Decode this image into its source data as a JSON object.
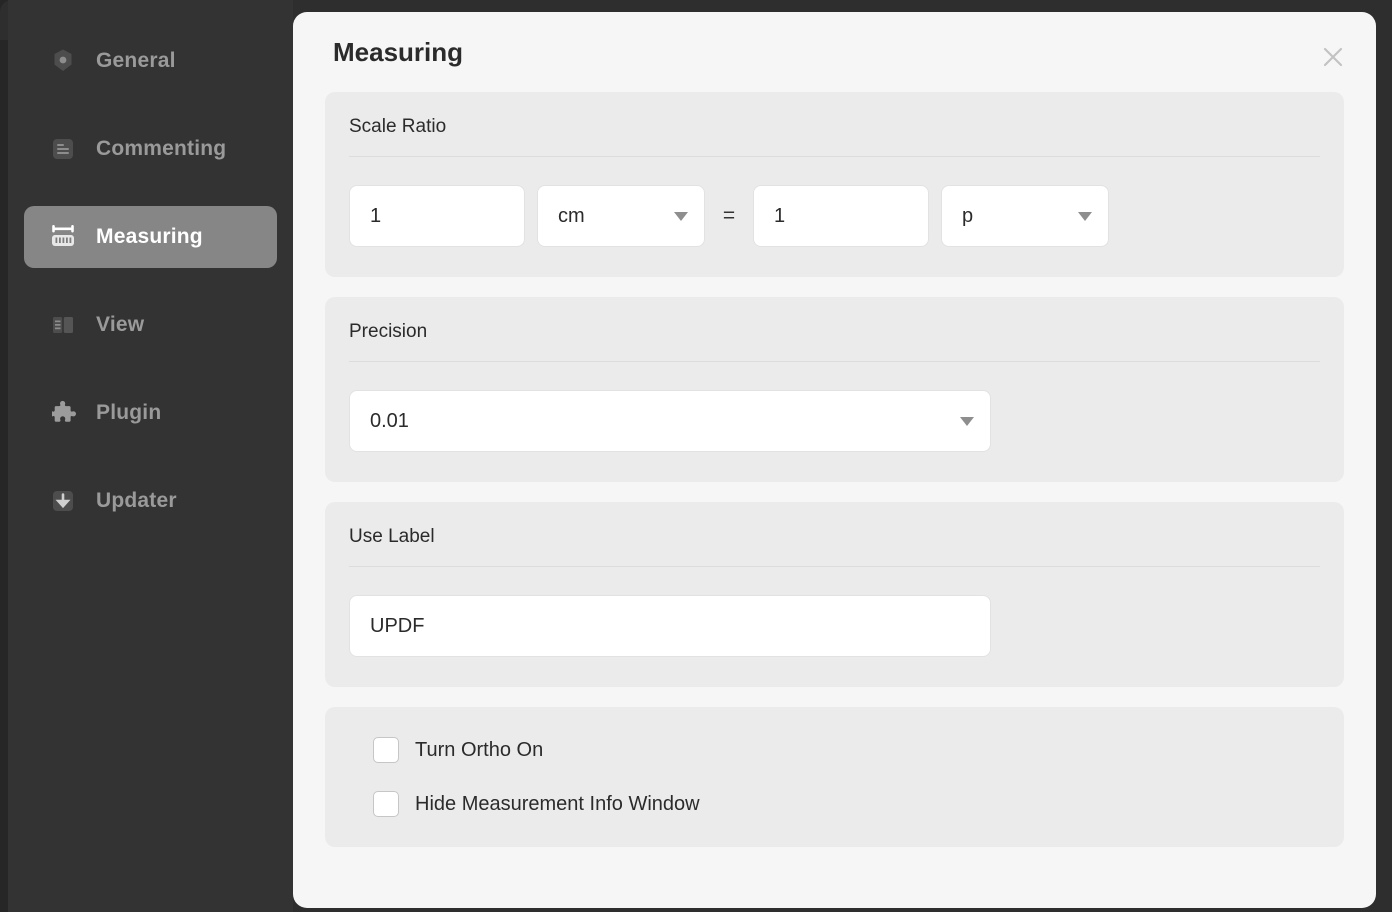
{
  "sidebar": {
    "items": [
      {
        "id": "general",
        "label": "General",
        "icon": "gear-icon",
        "active": false
      },
      {
        "id": "commenting",
        "label": "Commenting",
        "icon": "comment-doc-icon",
        "active": false
      },
      {
        "id": "measuring",
        "label": "Measuring",
        "icon": "ruler-icon",
        "active": true
      },
      {
        "id": "view",
        "label": "View",
        "icon": "book-icon",
        "active": false
      },
      {
        "id": "plugin",
        "label": "Plugin",
        "icon": "puzzle-icon",
        "active": false
      },
      {
        "id": "updater",
        "label": "Updater",
        "icon": "download-icon",
        "active": false
      }
    ]
  },
  "dialog": {
    "title": "Measuring",
    "close_label": "×"
  },
  "scale_ratio": {
    "title": "Scale Ratio",
    "left_value": "1",
    "left_unit": "cm",
    "equals": "=",
    "right_value": "1",
    "right_unit": "p"
  },
  "precision": {
    "title": "Precision",
    "value": "0.01"
  },
  "use_label": {
    "title": "Use Label",
    "value": "UPDF"
  },
  "options": {
    "items": [
      {
        "id": "turn-ortho-on",
        "label": "Turn Ortho On",
        "checked": false
      },
      {
        "id": "hide-measurement-info-window",
        "label": "Hide Measurement Info Window",
        "checked": false
      }
    ]
  },
  "colors": {
    "app_background": "#2e2e2e",
    "sidebar_background": "#333333",
    "sidebar_active": "#868686",
    "dialog_background": "#f6f6f6",
    "panel_background": "#ebebeb",
    "text_primary": "#2b2b2b",
    "text_muted": "#9a9a9a",
    "input_background": "#ffffff"
  }
}
